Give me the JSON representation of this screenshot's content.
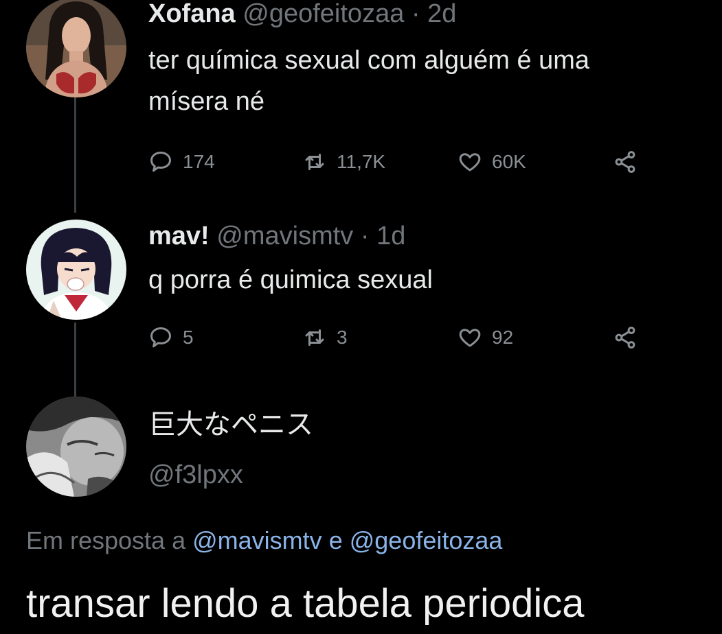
{
  "tweets": [
    {
      "name": "Xofana",
      "handle": "@geofeitozaa",
      "separator": "·",
      "time": "2d",
      "text_lines": [
        "ter química sexual com alguém é uma",
        "mísera né"
      ],
      "replies": "174",
      "retweets": "11,7K",
      "likes": "60K"
    },
    {
      "name": "mav!",
      "handle": "@mavismtv",
      "separator": "·",
      "time": "1d",
      "text_lines": [
        "q porra é quimica sexual"
      ],
      "replies": "5",
      "retweets": "3",
      "likes": "92"
    }
  ],
  "main_tweet": {
    "name": "巨大なペニス",
    "handle": "@f3lpxx",
    "reply_prefix": "Em resposta a",
    "reply_mention_1": "@mavismtv",
    "reply_and": "e",
    "reply_mention_2": "@geofeitozaa",
    "text": "transar lendo a tabela periodica"
  },
  "icons": [
    "reply-icon",
    "retweet-icon",
    "like-icon",
    "share-icon"
  ],
  "colors": {
    "background": "#000000",
    "text": "#e7e9ea",
    "muted": "#71767b",
    "mention": "#8ab4e8",
    "thread_line": "#3a3f44"
  }
}
